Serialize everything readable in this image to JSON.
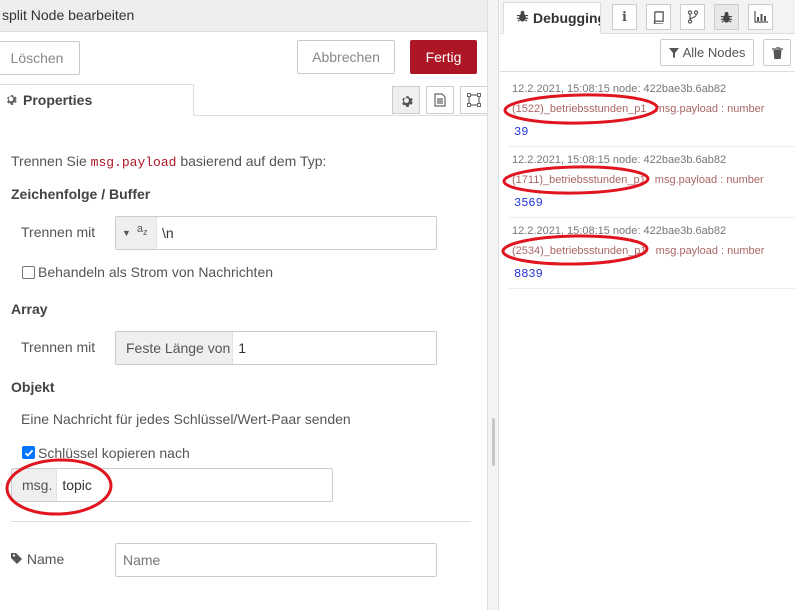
{
  "editor": {
    "title": "split Node bearbeiten",
    "delete_label": "Löschen",
    "cancel_label": "Abbrechen",
    "done_label": "Fertig",
    "tab_properties": "Properties"
  },
  "form": {
    "intro_prefix": "Trennen Sie",
    "intro_code": "msg.payload",
    "intro_suffix": "basierend auf dem Typ:",
    "string_section": "Zeichenfolge / Buffer",
    "split_with_label": "Trennen mit",
    "string_type_icon_text": "a",
    "string_type_icon_sub": "z",
    "string_value": "\\n",
    "stream_label": "Behandeln als Strom von Nachrichten",
    "stream_checked": false,
    "array_section": "Array",
    "array_split_label": "Trennen mit",
    "array_prefix": "Feste Länge von",
    "array_value": "1",
    "object_section": "Objekt",
    "object_desc": "Eine Nachricht für jedes Schlüssel/Wert-Paar senden",
    "copy_key_label": "Schlüssel kopieren nach",
    "copy_key_checked": true,
    "msg_prefix": "msg.",
    "msg_value": "topic",
    "name_label": "Name",
    "name_placeholder": "Name"
  },
  "sidebar": {
    "debug_tab_label": "Debugging",
    "filter_label": "Alle Nodes",
    "messages": [
      {
        "meta": "12.2.2021, 15:08:15   node: 422bae3b.6ab82",
        "topic": "(1522)_betriebsstunden_p1",
        "type": "msg.payload : number",
        "value": "39"
      },
      {
        "meta": "12.2.2021, 15:08:15   node: 422bae3b.6ab82",
        "topic": "(1711)_betriebsstunden_p1",
        "type": "msg.payload : number",
        "value": "3569"
      },
      {
        "meta": "12.2.2021, 15:08:15   node: 422bae3b.6ab82",
        "topic": "(2534)_betriebsstunden_p1",
        "type": "msg.payload : number",
        "value": "8839"
      }
    ]
  },
  "colors": {
    "accent": "#ad1625",
    "annotation": "#e0151f",
    "value_blue": "#2033d6"
  }
}
